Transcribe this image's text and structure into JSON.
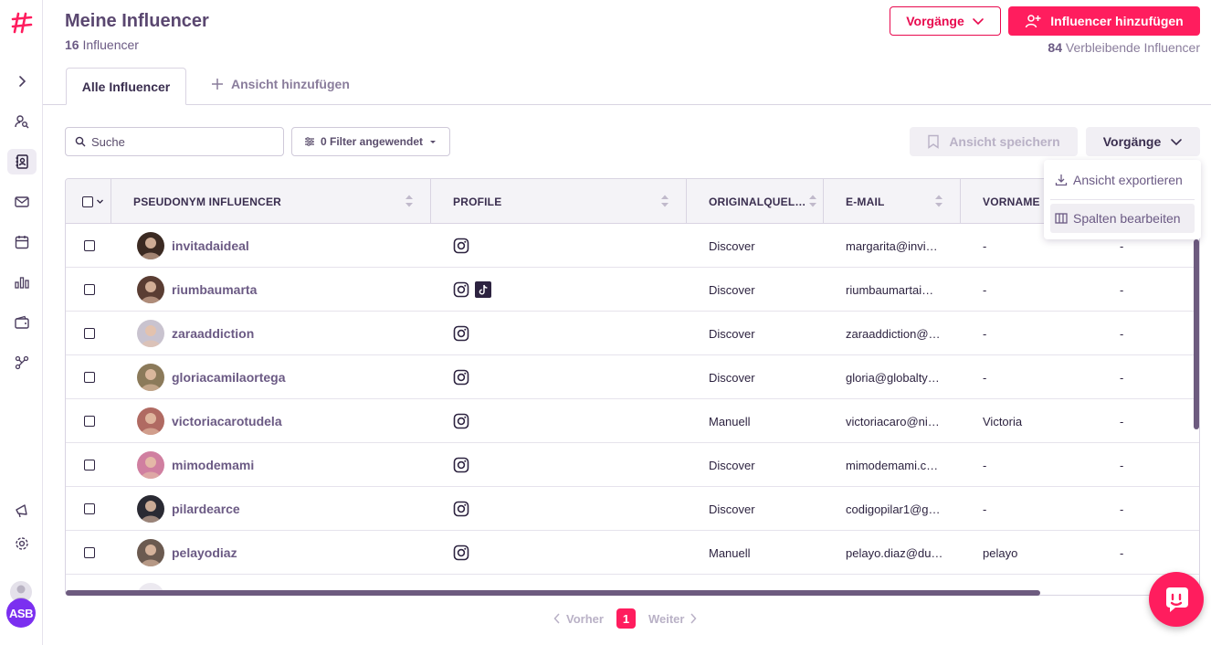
{
  "header": {
    "title": "Meine Influencer",
    "count": "16",
    "count_label": "Influencer",
    "actions_button": "Vorgänge",
    "add_button": "Influencer hinzufügen",
    "remaining_count": "84",
    "remaining_label": "Verbleibende Influencer"
  },
  "tabs": {
    "active": "Alle Influencer",
    "add_view": "Ansicht hinzufügen"
  },
  "toolbar": {
    "search_placeholder": "Suche",
    "filter_label": "0 Filter angewendet",
    "save_view": "Ansicht speichern",
    "actions": "Vorgänge"
  },
  "dropdown": {
    "export": "Ansicht exportieren",
    "edit_columns": "Spalten bearbeiten"
  },
  "table": {
    "columns": [
      "PSEUDONYM INFLUENCER",
      "PROFILE",
      "ORIGINALQUEL…",
      "E-MAIL",
      "VORNAME"
    ],
    "rows": [
      {
        "name": "invitadaideal",
        "tiktok": false,
        "source": "Discover",
        "email": "margarita@invi…",
        "firstname": "-",
        "extra": "-"
      },
      {
        "name": "riumbaumarta",
        "tiktok": true,
        "source": "Discover",
        "email": "riumbaumartai…",
        "firstname": "-",
        "extra": "-"
      },
      {
        "name": "zaraaddiction",
        "tiktok": false,
        "source": "Discover",
        "email": "zaraaddiction@…",
        "firstname": "-",
        "extra": "-"
      },
      {
        "name": "gloriacamilaortega",
        "tiktok": false,
        "source": "Discover",
        "email": "gloria@globalty…",
        "firstname": "-",
        "extra": "-"
      },
      {
        "name": "victoriacarotudela",
        "tiktok": false,
        "source": "Manuell",
        "email": "victoriacaro@ni…",
        "firstname": "Victoria",
        "extra": "-"
      },
      {
        "name": "mimodemami",
        "tiktok": false,
        "source": "Discover",
        "email": "mimodemami.c…",
        "firstname": "-",
        "extra": "-"
      },
      {
        "name": "pilardearce",
        "tiktok": false,
        "source": "Discover",
        "email": "codigopilar1@g…",
        "firstname": "-",
        "extra": "-"
      },
      {
        "name": "pelayodiaz",
        "tiktok": false,
        "source": "Manuell",
        "email": "pelayo.diaz@du…",
        "firstname": "pelayo",
        "extra": "-"
      }
    ],
    "avatar_colors": [
      "#3b2a22",
      "#5a3d33",
      "#c9c3cf",
      "#8b7a5a",
      "#b06a62",
      "#d07fa0",
      "#2a2a33",
      "#6b5a50"
    ]
  },
  "pagination": {
    "prev": "Vorher",
    "current": "1",
    "next": "Weiter"
  },
  "user": {
    "initials": "ASB"
  },
  "colors": {
    "brand": "#ff1d5e",
    "text": "#3a2e4f",
    "muted": "#6b5a84"
  }
}
